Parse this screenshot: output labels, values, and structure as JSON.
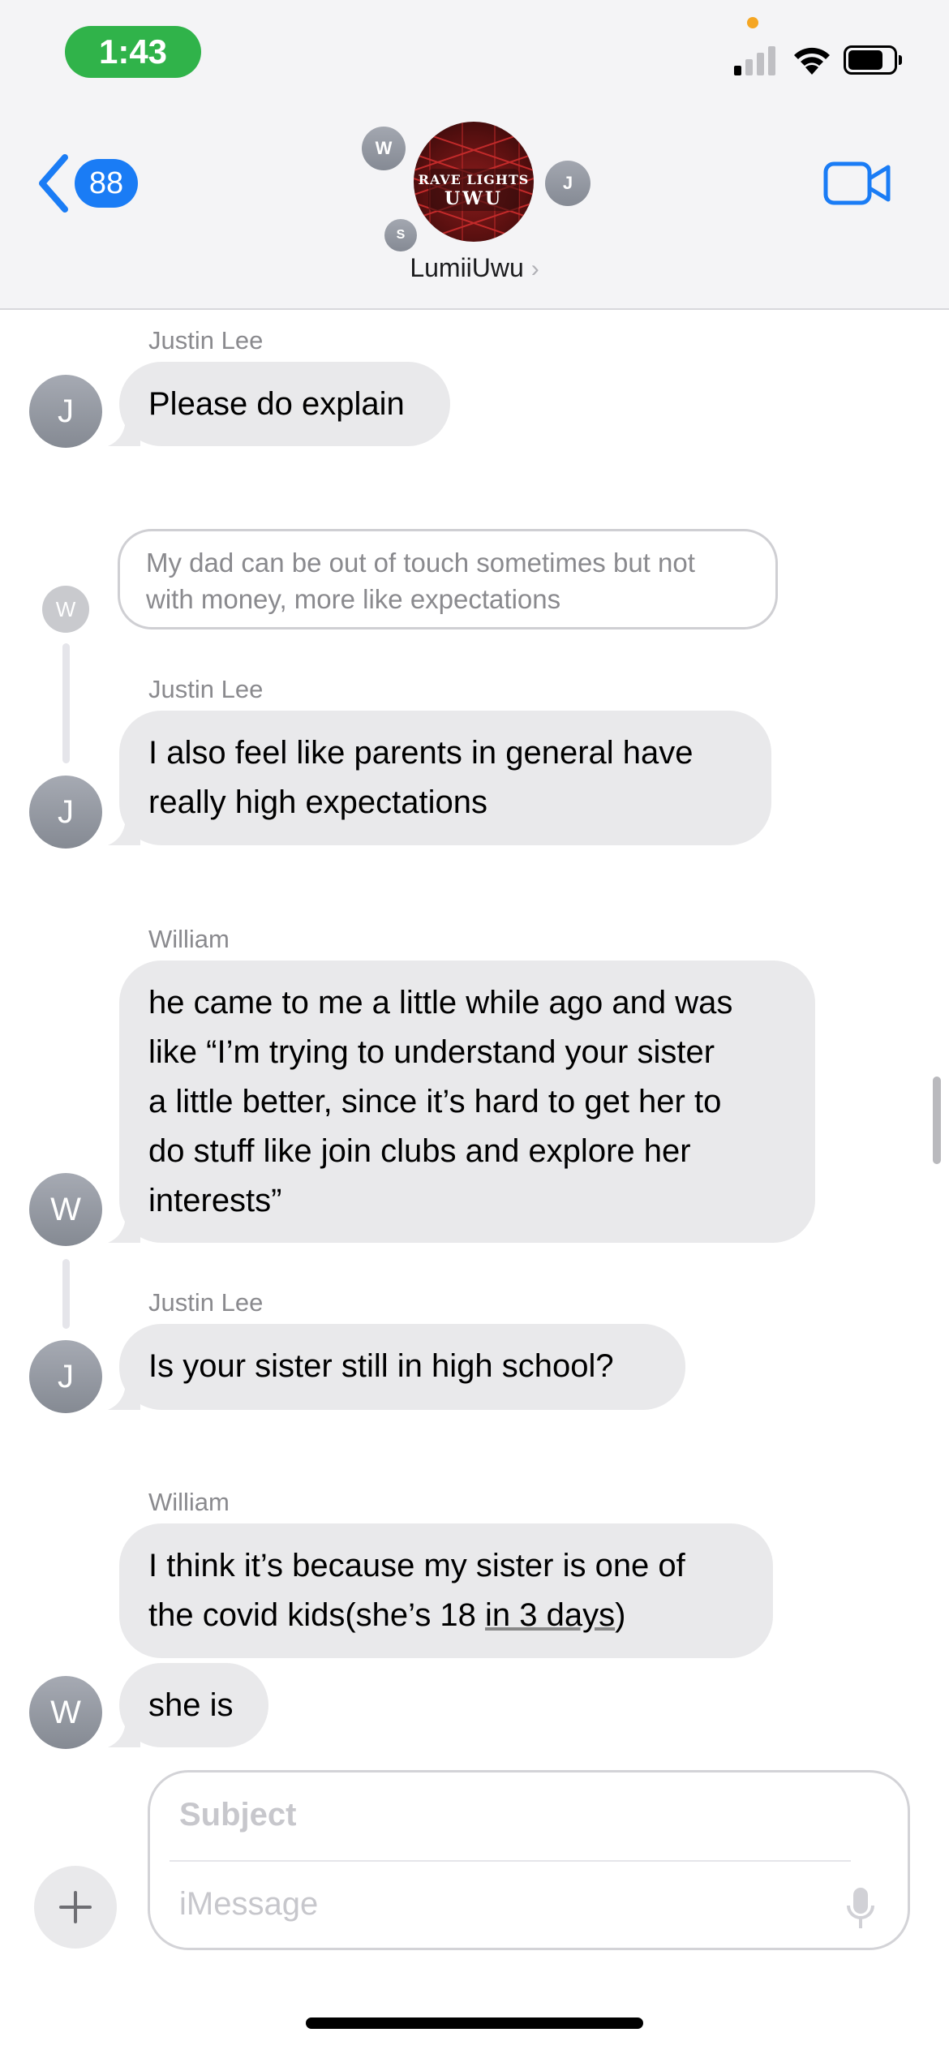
{
  "status_bar": {
    "time": "1:43"
  },
  "header": {
    "back_badge": "88",
    "group_name": "LumiiUwu",
    "chevron": "›",
    "photo_text_top": "RAVE LIGHTS",
    "photo_text_bottom": "UWU",
    "member_initials": [
      "W",
      "J",
      "S"
    ],
    "icons": [
      "back-chevron-icon",
      "video-camera-icon"
    ]
  },
  "messages": [
    {
      "sender": "Justin Lee",
      "avatar": "J",
      "text": "Please do explain"
    },
    {
      "reply_quote": "My dad can be out of touch sometimes but not with money, more like expectations",
      "reply_avatar": "W"
    },
    {
      "sender": "Justin Lee",
      "avatar": "J",
      "lines": [
        "I also feel like parents in general have",
        "really high expectations"
      ]
    },
    {
      "sender": "William",
      "avatar": "W",
      "lines": [
        "he came to me a little while ago and was",
        "like “I’m trying to understand your sister",
        "a little better, since it’s hard to get her to",
        "do stuff like join clubs and explore her",
        "interests”"
      ]
    },
    {
      "sender": "Justin Lee",
      "avatar": "J",
      "text": "Is your sister still in high school?"
    },
    {
      "sender": "William",
      "avatar": "W",
      "line1": "I think it’s because my sister is one of",
      "line2_pre": "the covid kids(she’s 18 ",
      "line2_link": "in 3 days",
      "line2_post": ")",
      "followup": "she is"
    }
  ],
  "composer": {
    "subject_placeholder": "Subject",
    "message_placeholder": "iMessage",
    "plus_label": "+"
  },
  "colors": {
    "time_pill": "#30b34a",
    "accent_blue": "#1a7cf5",
    "bubble_gray": "#e9e9eb",
    "avatar_gray": "#8e939c"
  }
}
